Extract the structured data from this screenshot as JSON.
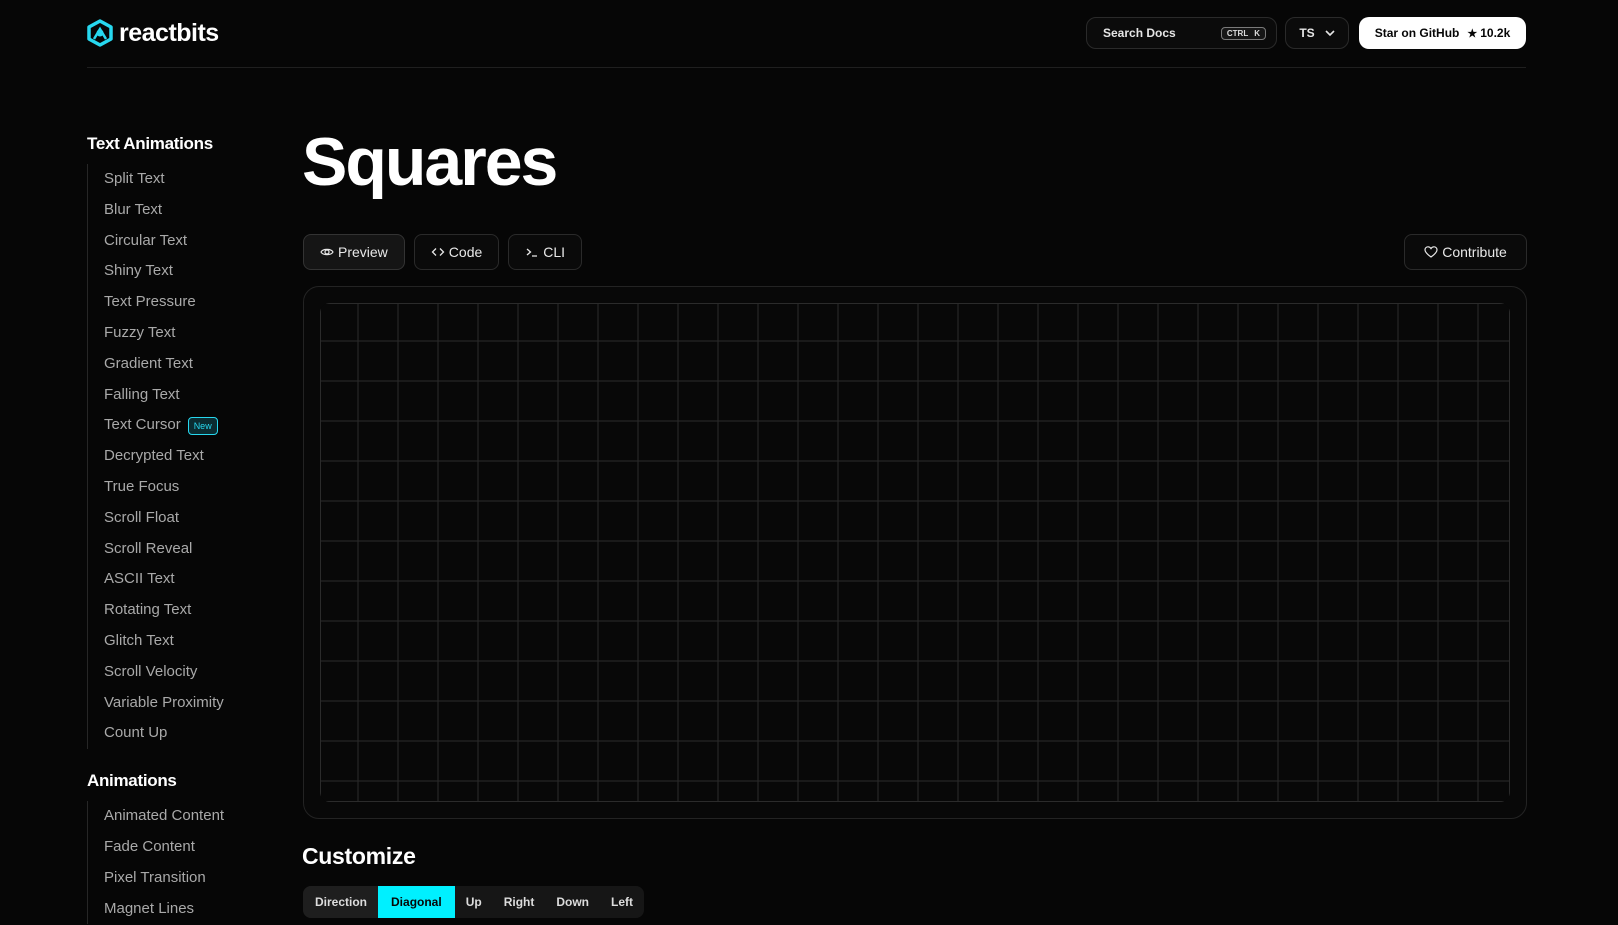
{
  "header": {
    "logo_text": "reactbits",
    "search_label": "Search Docs",
    "kbd_ctrl": "CTRL",
    "kbd_key": "K",
    "lang": "TS",
    "github_label": "Star on GitHub",
    "github_count": "10.2k"
  },
  "sidebar": {
    "sections": [
      {
        "title": "Text Animations",
        "items": [
          {
            "label": "Split Text"
          },
          {
            "label": "Blur Text"
          },
          {
            "label": "Circular Text"
          },
          {
            "label": "Shiny Text"
          },
          {
            "label": "Text Pressure"
          },
          {
            "label": "Fuzzy Text"
          },
          {
            "label": "Gradient Text"
          },
          {
            "label": "Falling Text"
          },
          {
            "label": "Text Cursor",
            "badge": "New"
          },
          {
            "label": "Decrypted Text"
          },
          {
            "label": "True Focus"
          },
          {
            "label": "Scroll Float"
          },
          {
            "label": "Scroll Reveal"
          },
          {
            "label": "ASCII Text"
          },
          {
            "label": "Rotating Text"
          },
          {
            "label": "Glitch Text"
          },
          {
            "label": "Scroll Velocity"
          },
          {
            "label": "Variable Proximity"
          },
          {
            "label": "Count Up"
          }
        ]
      },
      {
        "title": "Animations",
        "items": [
          {
            "label": "Animated Content"
          },
          {
            "label": "Fade Content"
          },
          {
            "label": "Pixel Transition"
          },
          {
            "label": "Magnet Lines"
          }
        ]
      }
    ]
  },
  "main": {
    "title": "Squares",
    "tabs": [
      {
        "label": "Preview",
        "icon": "eye-icon",
        "active": true
      },
      {
        "label": "Code",
        "icon": "code-icon",
        "active": false
      },
      {
        "label": "CLI",
        "icon": "terminal-icon",
        "active": false
      }
    ],
    "contribute_label": "Contribute",
    "customize_title": "Customize",
    "direction": {
      "label": "Direction",
      "options": [
        "Diagonal",
        "Up",
        "Right",
        "Down",
        "Left"
      ],
      "selected": "Diagonal"
    }
  },
  "colors": {
    "background": "#060606",
    "accent": "#00f0ff",
    "badge": "#27d8ef",
    "grid_line": "#2b2b2b"
  }
}
